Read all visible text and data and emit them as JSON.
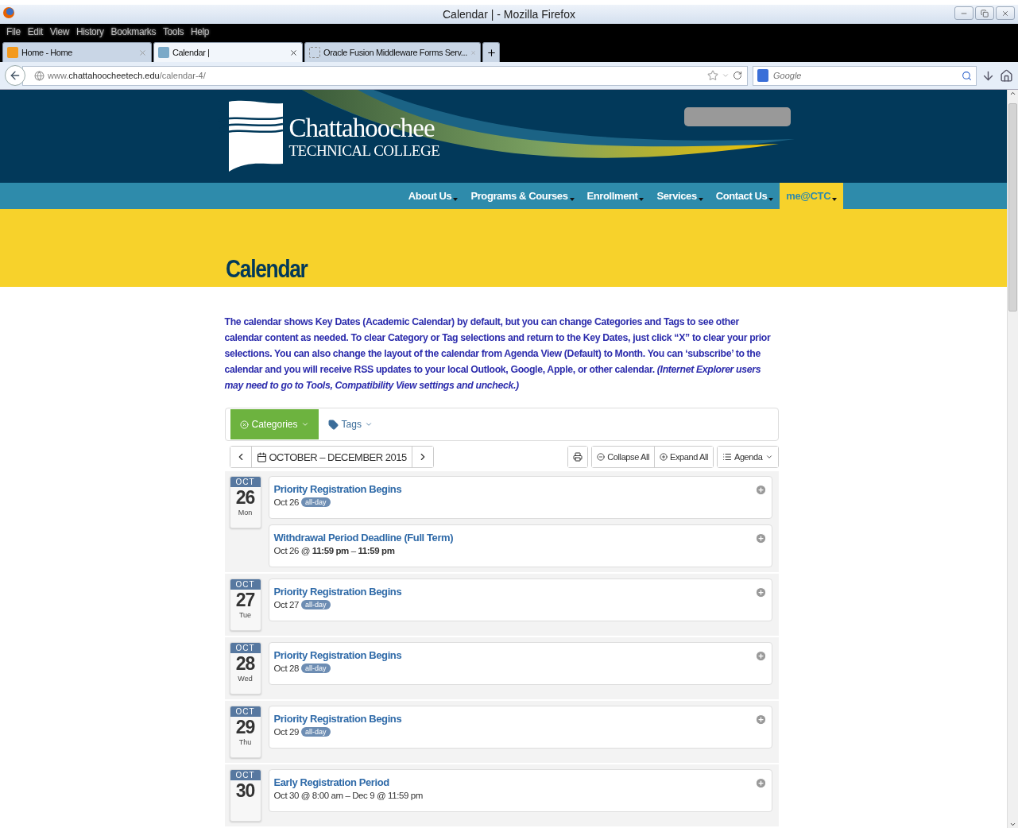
{
  "window": {
    "title": "Calendar | - Mozilla Firefox"
  },
  "menu": [
    "File",
    "Edit",
    "View",
    "History",
    "Bookmarks",
    "Tools",
    "Help"
  ],
  "tabs": [
    {
      "label": "Home - Home",
      "selected": false
    },
    {
      "label": "Calendar |",
      "selected": true
    },
    {
      "label": "Oracle Fusion Middleware Forms Serv...",
      "selected": false
    }
  ],
  "address": {
    "url": "www.**chattahoocheetech.edu**/calendar-4/"
  },
  "search": {
    "placeholder": "Google"
  },
  "site": {
    "logo_name": "Chattahoochee",
    "logo_sub": "TECHNICAL COLLEGE",
    "nav": [
      {
        "label": "About Us",
        "selected": false
      },
      {
        "label": "Programs & Courses",
        "selected": false
      },
      {
        "label": "Enrollment",
        "selected": false
      },
      {
        "label": "Services",
        "selected": false
      },
      {
        "label": "Contact Us",
        "selected": false
      },
      {
        "label": "me@CTC",
        "selected": true
      }
    ],
    "page_title": "Calendar",
    "intro": "The calendar shows Key Dates (Academic Calendar) by default, but you can change Categories and Tags to see other calendar content as needed. To clear Category or Tag selections and return to the Key Dates, just click “X” to clear your prior selections. You can also change the layout of the calendar from Agenda View (Default) to Month. You can ‘subscribe’ to the calendar and you will receive RSS updates to your local Outlook, Google, Apple, or other calendar. *(Internet Explorer users may need to go to Tools, Compatibility View settings and uncheck.)*",
    "filters": [
      {
        "label": "Categories",
        "selected": true
      },
      {
        "label": "Tags",
        "selected": false
      }
    ],
    "range": "OCTOBER – DECEMBER 2015",
    "actions": [
      "Collapse All",
      "Expand All"
    ],
    "view": "Agenda",
    "days": [
      {
        "month": "OCT",
        "day": "26",
        "weekday": "Mon",
        "events": [
          {
            "title": "Priority Registration Begins",
            "when": "Oct 26",
            "badge": "all-day"
          },
          {
            "title": "Withdrawal Period Deadline (Full Term)",
            "when": "Oct 26 @ **11:59 pm** – **11:59 pm**"
          }
        ]
      },
      {
        "month": "OCT",
        "day": "27",
        "weekday": "Tue",
        "events": [
          {
            "title": "Priority Registration Begins",
            "when": "Oct 27",
            "badge": "all-day"
          }
        ]
      },
      {
        "month": "OCT",
        "day": "28",
        "weekday": "Wed",
        "events": [
          {
            "title": "Priority Registration Begins",
            "when": "Oct 28",
            "badge": "all-day"
          }
        ]
      },
      {
        "month": "OCT",
        "day": "29",
        "weekday": "Thu",
        "events": [
          {
            "title": "Priority Registration Begins",
            "when": "Oct 29",
            "badge": "all-day"
          }
        ]
      },
      {
        "month": "OCT",
        "day": "30",
        "events": [
          {
            "title": "Early Registration Period",
            "when": "Oct 30 @ 8:00 am – Dec 9 @ 11:59 pm"
          }
        ]
      }
    ]
  }
}
